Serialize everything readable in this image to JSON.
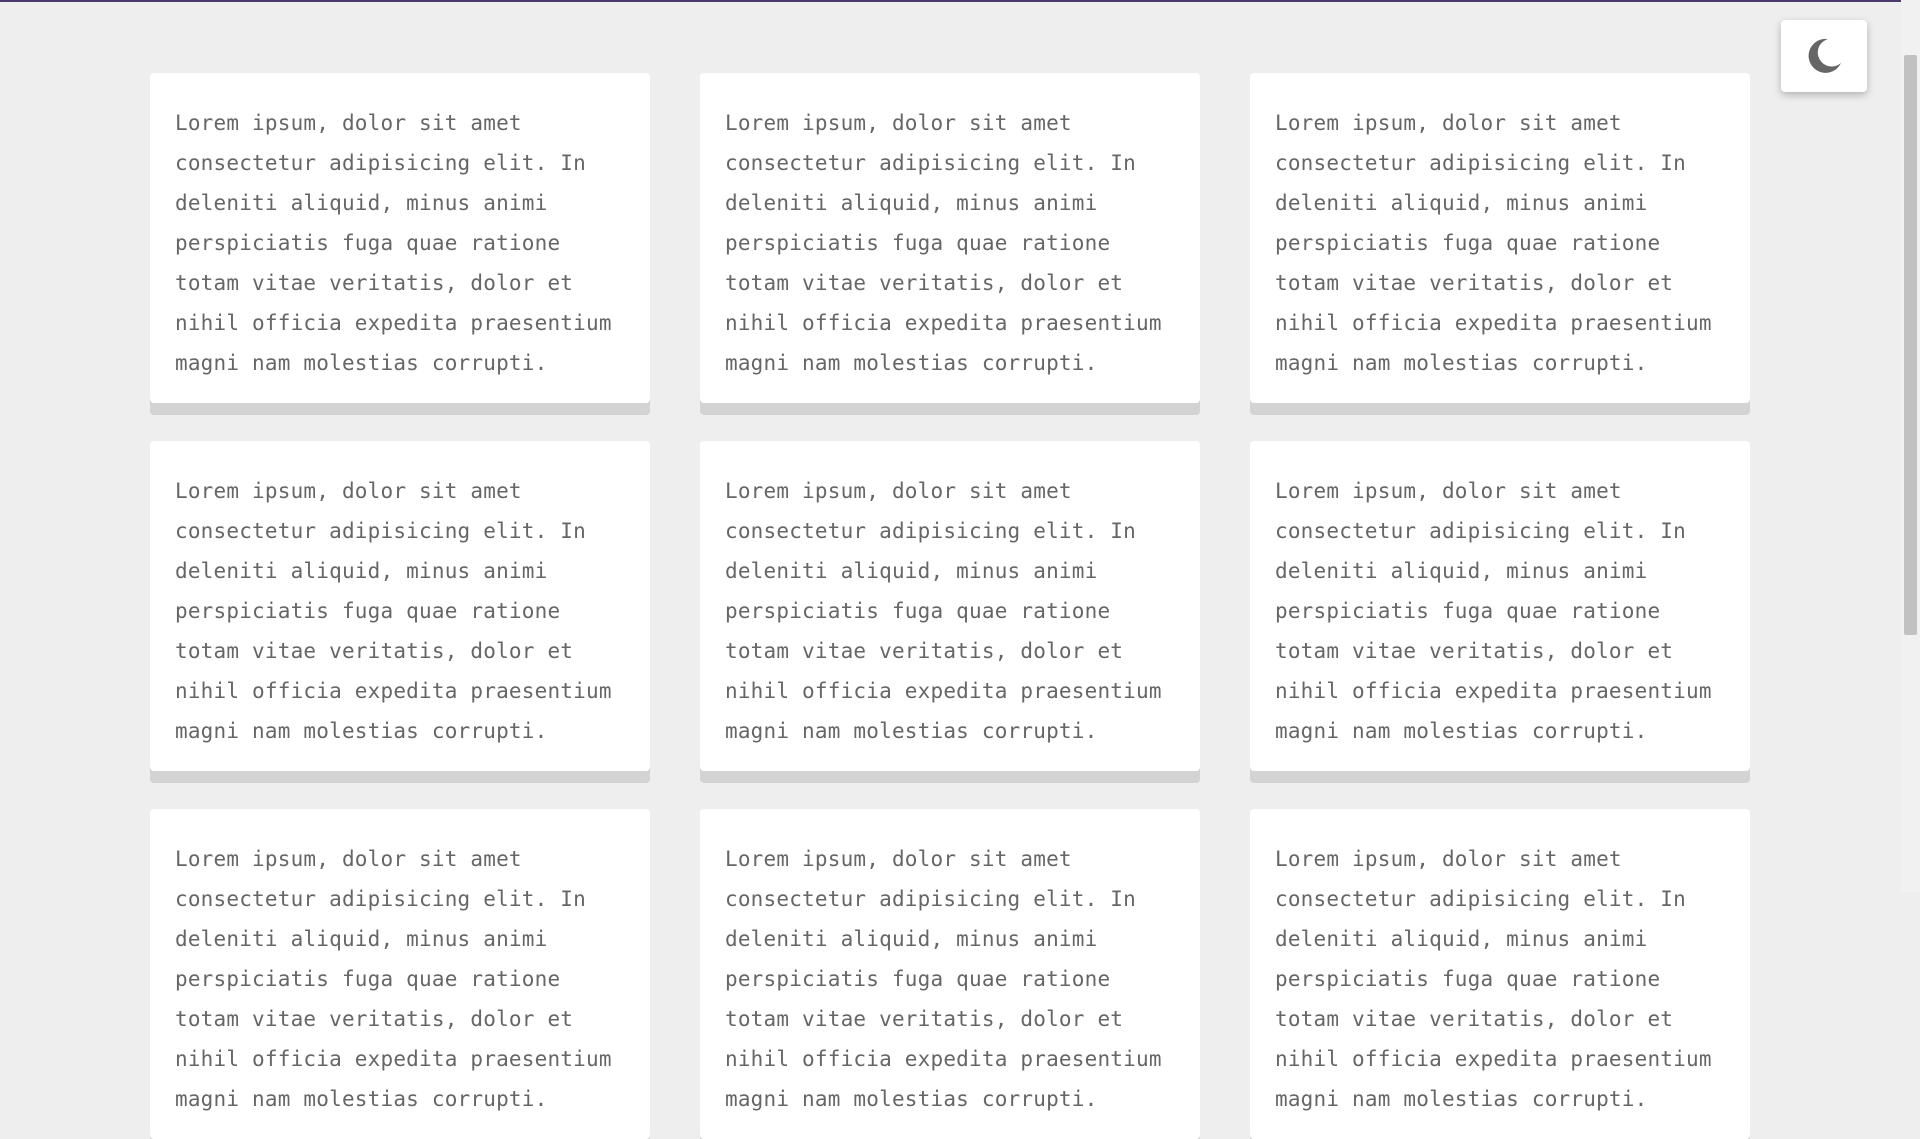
{
  "theme_toggle": {
    "icon": "moon-icon",
    "icon_color": "#666666"
  },
  "colors": {
    "background": "#eeeeee",
    "card": "#ffffff",
    "card_shadow": "#d3d3d3",
    "text": "#666666",
    "top_border": "#4a3a6e"
  },
  "cards": [
    {
      "text": "Lorem ipsum, dolor sit amet\nconsectetur adipisicing elit. In\ndeleniti aliquid, minus animi\nperspiciatis fuga quae ratione\ntotam vitae veritatis, dolor et\nnihil officia expedita praesentium\nmagni nam molestias corrupti."
    },
    {
      "text": "Lorem ipsum, dolor sit amet\nconsectetur adipisicing elit. In\ndeleniti aliquid, minus animi\nperspiciatis fuga quae ratione\ntotam vitae veritatis, dolor et\nnihil officia expedita praesentium\nmagni nam molestias corrupti."
    },
    {
      "text": "Lorem ipsum, dolor sit amet\nconsectetur adipisicing elit. In\ndeleniti aliquid, minus animi\nperspiciatis fuga quae ratione\ntotam vitae veritatis, dolor et\nnihil officia expedita praesentium\nmagni nam molestias corrupti."
    },
    {
      "text": "Lorem ipsum, dolor sit amet\nconsectetur adipisicing elit. In\ndeleniti aliquid, minus animi\nperspiciatis fuga quae ratione\ntotam vitae veritatis, dolor et\nnihil officia expedita praesentium\nmagni nam molestias corrupti."
    },
    {
      "text": "Lorem ipsum, dolor sit amet\nconsectetur adipisicing elit. In\ndeleniti aliquid, minus animi\nperspiciatis fuga quae ratione\ntotam vitae veritatis, dolor et\nnihil officia expedita praesentium\nmagni nam molestias corrupti."
    },
    {
      "text": "Lorem ipsum, dolor sit amet\nconsectetur adipisicing elit. In\ndeleniti aliquid, minus animi\nperspiciatis fuga quae ratione\ntotam vitae veritatis, dolor et\nnihil officia expedita praesentium\nmagni nam molestias corrupti."
    },
    {
      "text": "Lorem ipsum, dolor sit amet\nconsectetur adipisicing elit. In\ndeleniti aliquid, minus animi\nperspiciatis fuga quae ratione\ntotam vitae veritatis, dolor et\nnihil officia expedita praesentium\nmagni nam molestias corrupti."
    },
    {
      "text": "Lorem ipsum, dolor sit amet\nconsectetur adipisicing elit. In\ndeleniti aliquid, minus animi\nperspiciatis fuga quae ratione\ntotam vitae veritatis, dolor et\nnihil officia expedita praesentium\nmagni nam molestias corrupti."
    },
    {
      "text": "Lorem ipsum, dolor sit amet\nconsectetur adipisicing elit. In\ndeleniti aliquid, minus animi\nperspiciatis fuga quae ratione\ntotam vitae veritatis, dolor et\nnihil officia expedita praesentium\nmagni nam molestias corrupti."
    }
  ]
}
